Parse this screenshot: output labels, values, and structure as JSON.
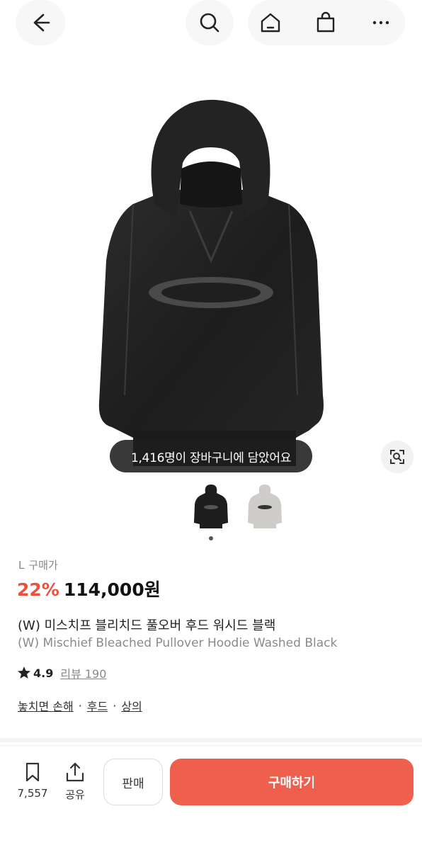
{
  "nav": {
    "back_icon": "arrow-left-icon",
    "search_icon": "search-icon",
    "home_icon": "home-icon",
    "bag_icon": "shopping-bag-icon",
    "more_icon": "more-horizontal-icon"
  },
  "image": {
    "toast": "1,416명이 장바구니에 담았어요",
    "lens_icon": "image-search-icon",
    "thumbnails": [
      "black-hoodie-thumb",
      "grey-hoodie-thumb"
    ],
    "active_index": 0
  },
  "product": {
    "size": "L",
    "price_label": "구매가",
    "discount": "22%",
    "price": "114,000원",
    "name_ko": "(W) 미스치프 블리치드 풀오버 후드 워시드 블랙",
    "name_en": "(W) Mischief Bleached Pullover Hoodie Washed Black",
    "rating": "4.9",
    "review_label": "리뷰 190",
    "tags": [
      "놓치면 손해",
      "후드",
      "상의"
    ],
    "tag_separator": "·"
  },
  "bottom": {
    "wish_count": "7,557",
    "share_label": "공유",
    "sell_label": "판매",
    "buy_label": "구매하기"
  },
  "colors": {
    "accent": "#ee5f4e",
    "discount": "#e8523f",
    "toast_bg": "#1e1e1e"
  }
}
